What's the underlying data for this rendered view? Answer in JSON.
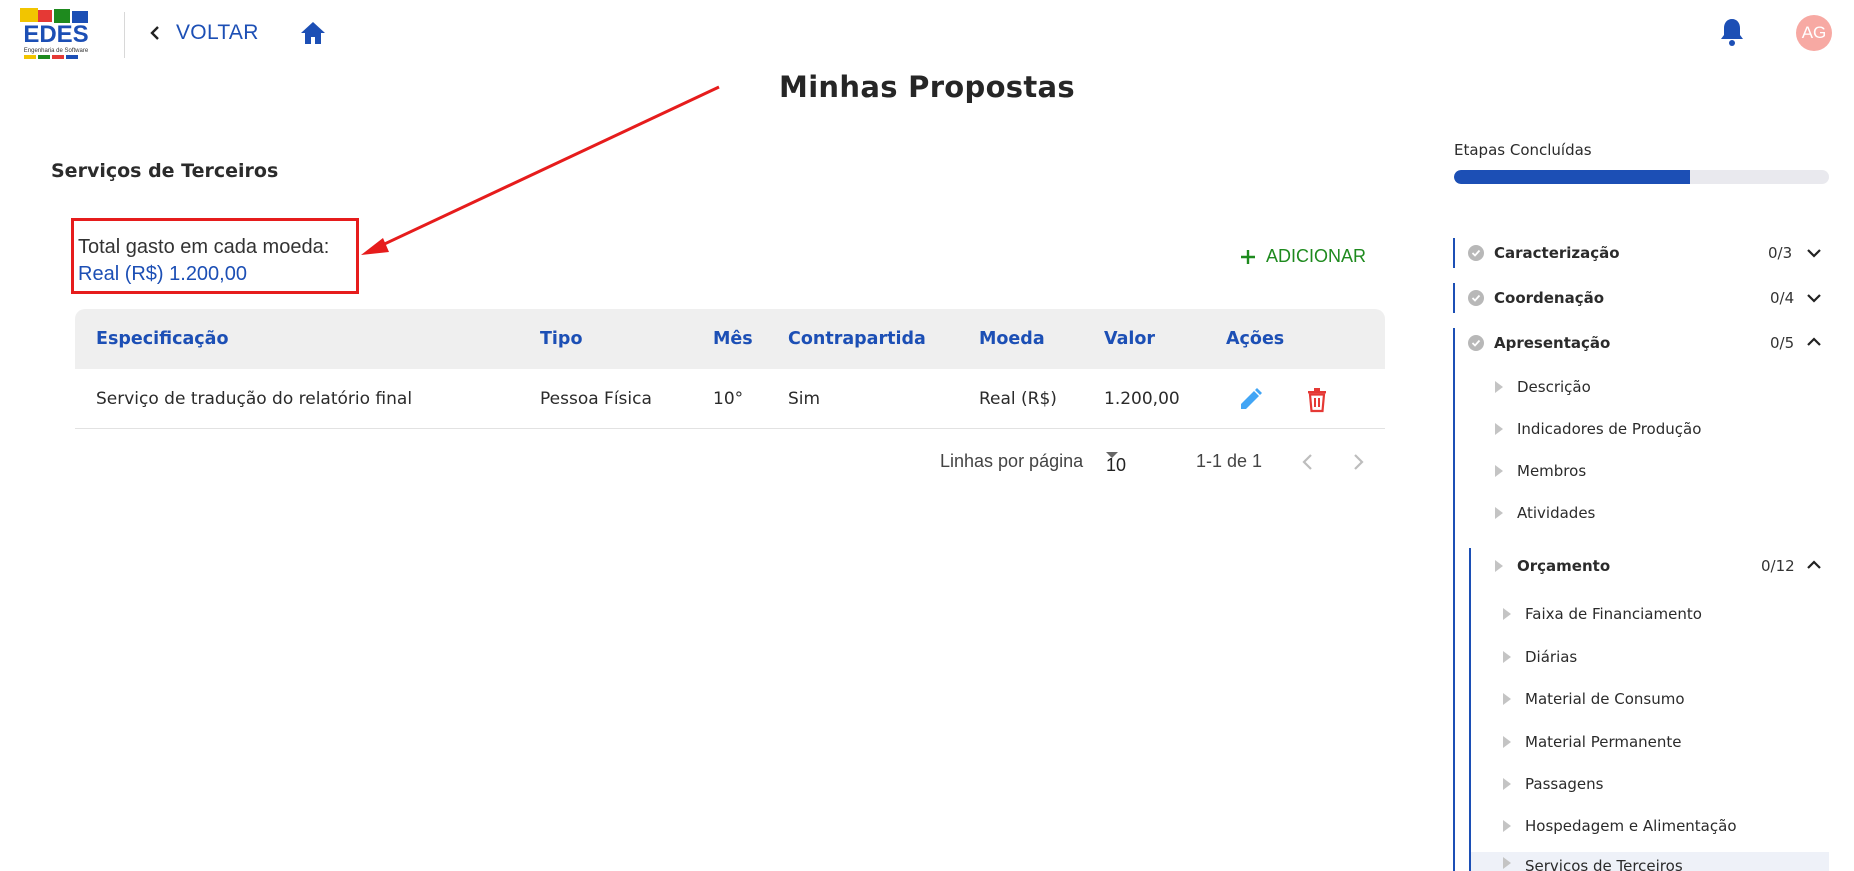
{
  "header": {
    "logo_text": "EDES",
    "logo_subtext": "Engenharia de Software",
    "back_label": "VOLTAR",
    "avatar_initials": "AG"
  },
  "page_title": "Minhas Propostas",
  "section": {
    "title": "Serviços de Terceiros",
    "total_label": "Total gasto em cada moeda:",
    "total_value": "Real (R$) 1.200,00",
    "add_label": "ADICIONAR"
  },
  "table": {
    "headers": [
      "Especificação",
      "Tipo",
      "Mês",
      "Contrapartida",
      "Moeda",
      "Valor",
      "Ações"
    ],
    "rows": [
      {
        "especificacao": "Serviço de tradução do relatório final",
        "tipo": "Pessoa Física",
        "mes": "10°",
        "contrapartida": "Sim",
        "moeda": "Real (R$)",
        "valor": "1.200,00"
      }
    ]
  },
  "pagination": {
    "rows_per_page_label": "Linhas por página",
    "rows_per_page_value": "10",
    "range_text": "1-1 de 1"
  },
  "sidebar": {
    "steps_label": "Etapas Concluídas",
    "progress_fraction": 0.63,
    "sections": [
      {
        "label": "Caracterização",
        "count": "0/3"
      },
      {
        "label": "Coordenação",
        "count": "0/4"
      },
      {
        "label": "Apresentação",
        "count": "0/5"
      }
    ],
    "apresentacao_items": [
      "Descrição",
      "Indicadores de Produção",
      "Membros",
      "Atividades"
    ],
    "orcamento": {
      "label": "Orçamento",
      "count": "0/12",
      "items": [
        "Faixa de Financiamento",
        "Diárias",
        "Material de Consumo",
        "Material Permanente",
        "Passagens",
        "Hospedagem e Alimentação",
        "Serviços de Terceiros"
      ]
    }
  },
  "colors": {
    "primary": "#1c4fb5",
    "add_green": "#1e8a1e",
    "highlight_red": "#e61c1c",
    "edit_blue": "#42a5f5",
    "delete_red": "#e53935",
    "avatar_bg": "#f7a9a3"
  }
}
